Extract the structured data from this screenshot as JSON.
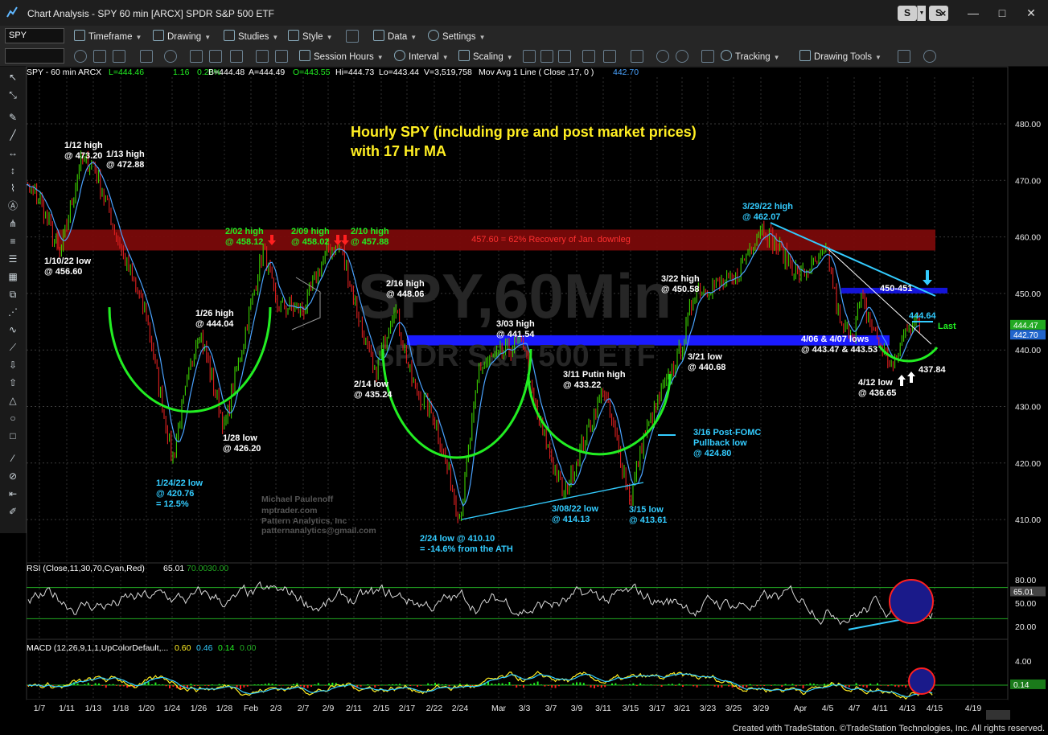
{
  "window": {
    "title": "Chart Analysis - SPY 60 min [ARCX] SPDR S&P 500 ETF",
    "s_button": "S",
    "link_button": "S"
  },
  "toolbar1": {
    "symbol": "SPY",
    "items": [
      "Timeframe",
      "Drawing",
      "Studies",
      "Style",
      "Data",
      "Settings"
    ]
  },
  "toolbar2": {
    "items": [
      "Session Hours",
      "Interval",
      "Scaling",
      "Tracking",
      "Drawing Tools"
    ]
  },
  "header": {
    "symbol": "SPY - 60 min  ARCX",
    "last": "L=444.46",
    "change": "1.16",
    "change_pct": "0.26%",
    "bid": "B=444.48",
    "ask": "A=444.49",
    "open": "O=443.55",
    "high": "Hi=444.73",
    "low": "Lo=443.44",
    "volume": "V=3,519,758",
    "ma_label": "Mov Avg 1 Line ( Close ,17,  0 )",
    "ma_value": "442.70"
  },
  "chart_title": [
    "Hourly SPY (including pre and post market prices)",
    "with 17 Hr MA"
  ],
  "watermark": {
    "main": "SPY,60Min",
    "sub": "SPDR S&P 500 ETF"
  },
  "credits": [
    "Michael Paulenoff",
    "mptrader.com",
    "Pattern Analytics, Inc",
    "patternanalytics@gmail.com"
  ],
  "zone_label": "457.60 = 62% Recovery of Jan. downleg",
  "colors": {
    "price_up": "#3cd000",
    "price_down": "#e02020",
    "ma": "#4aa3ff",
    "resistance_zone": "#7a0a0a",
    "support_zone": "#1a1aff",
    "cyan": "#33ccff",
    "green_arc": "#22ee22",
    "yellow": "#ffee22",
    "label_green": "#22ee22"
  },
  "annotations": [
    {
      "text": [
        "1/12 high",
        "@ 473.20"
      ]
    },
    {
      "text": [
        "1/13 high",
        "@ 472.88"
      ]
    },
    {
      "text": [
        "1/10/22 low",
        "@ 456.60"
      ]
    },
    {
      "text": [
        "2/02 high",
        "@ 458.12"
      ]
    },
    {
      "text": [
        "2/09 high",
        "@ 458.02"
      ]
    },
    {
      "text": [
        "2/10 high",
        "@ 457.88"
      ]
    },
    {
      "text": [
        "1/26 high",
        "@ 444.04"
      ]
    },
    {
      "text": [
        "2/16 high",
        "@ 448.06"
      ]
    },
    {
      "text": [
        "3/03 high",
        "@ 441.54"
      ]
    },
    {
      "text": [
        "3/22 high",
        "@ 450.58"
      ]
    },
    {
      "text": [
        "3/29/22 high",
        "@ 462.07"
      ]
    },
    {
      "text": [
        "2/14 low",
        "@ 435.24"
      ]
    },
    {
      "text": [
        "3/11 Putin high",
        "@ 433.22"
      ]
    },
    {
      "text": [
        "3/21 low",
        "@ 440.68"
      ]
    },
    {
      "text": [
        "1/28 low",
        "@ 426.20"
      ]
    },
    {
      "text": [
        "1/24/22 low",
        "@ 420.76",
        "= 12.5%"
      ]
    },
    {
      "text": [
        "2/24 low @ 410.10",
        "= -14.6% from the ATH"
      ]
    },
    {
      "text": [
        "3/08/22 low",
        "@ 414.13"
      ]
    },
    {
      "text": [
        "3/15 low",
        "@ 413.61"
      ]
    },
    {
      "text": [
        "3/16 Post-FOMC",
        "Pullback low",
        "@ 424.80"
      ]
    },
    {
      "text": [
        "4/06 & 4/07 lows",
        "@ 443.47 & 443.53"
      ]
    },
    {
      "text": [
        "4/12 low",
        "@ 436.65"
      ]
    },
    {
      "text": [
        "450-451"
      ]
    },
    {
      "text": [
        "444.64"
      ]
    },
    {
      "text": [
        "Last"
      ]
    },
    {
      "text": [
        "437.84"
      ]
    }
  ],
  "rsi": {
    "label": "RSI (Close,11,30,70,Cyan,Red)",
    "value": "65.01",
    "ob": "70.00",
    "os": "30.00",
    "axis": [
      "80.00",
      "50.00",
      "20.00"
    ],
    "tag": "65.01"
  },
  "macd": {
    "label": "MACD (12,26,9,1,1,UpColorDefault,...",
    "v1": "0.60",
    "v2": "0.46",
    "v3": "0.14",
    "v4": "0.00",
    "axis": [
      "4.00"
    ],
    "tag": "0.14"
  },
  "price_tags": [
    "444.47",
    "442.70"
  ],
  "footer": "Created with TradeStation. ©TradeStation Technologies, Inc. All rights reserved.",
  "chart_data": {
    "type": "line",
    "title": "Hourly SPY (including pre and post market prices)",
    "x_ticks": [
      "1/7",
      "1/11",
      "1/13",
      "1/18",
      "1/20",
      "1/24",
      "1/26",
      "1/28",
      "Feb",
      "2/3",
      "2/7",
      "2/9",
      "2/11",
      "2/15",
      "2/17",
      "2/22",
      "2/24",
      "Mar",
      "3/3",
      "3/7",
      "3/9",
      "3/11",
      "3/15",
      "3/17",
      "3/21",
      "3/23",
      "3/25",
      "3/29",
      "Apr",
      "4/5",
      "4/7",
      "4/11",
      "4/13",
      "4/15",
      "4/19"
    ],
    "y_ticks": [
      "480.00",
      "470.00",
      "460.00",
      "450.00",
      "440.00",
      "430.00",
      "420.00",
      "410.00"
    ],
    "ylim": [
      403,
      484
    ],
    "price_points": [
      [
        "1/5",
        470
      ],
      [
        "1/7",
        467
      ],
      [
        "1/10",
        456.6
      ],
      [
        "1/12",
        473.2
      ],
      [
        "1/13",
        472.88
      ],
      [
        "1/18",
        458
      ],
      [
        "1/20",
        446
      ],
      [
        "1/24",
        420.76
      ],
      [
        "1/26",
        444.04
      ],
      [
        "1/28",
        426.2
      ],
      [
        "2/2",
        458.12
      ],
      [
        "2/3",
        448
      ],
      [
        "2/7",
        447
      ],
      [
        "2/9",
        458.02
      ],
      [
        "2/10",
        457.88
      ],
      [
        "2/14",
        435.24
      ],
      [
        "2/16",
        448.06
      ],
      [
        "2/18",
        434
      ],
      [
        "2/22",
        428
      ],
      [
        "2/24",
        410.1
      ],
      [
        "2/28",
        437
      ],
      [
        "3/3",
        441.54
      ],
      [
        "3/4",
        432
      ],
      [
        "3/8",
        414.13
      ],
      [
        "3/11",
        433.22
      ],
      [
        "3/15",
        413.61
      ],
      [
        "3/16",
        424.8
      ],
      [
        "3/21",
        440.68
      ],
      [
        "3/22",
        450.58
      ],
      [
        "3/25",
        452
      ],
      [
        "3/29",
        462.07
      ],
      [
        "4/1",
        453
      ],
      [
        "4/5",
        457
      ],
      [
        "4/6",
        443.47
      ],
      [
        "4/7",
        443.53
      ],
      [
        "4/8",
        449
      ],
      [
        "4/11",
        441
      ],
      [
        "4/12",
        436.65
      ],
      [
        "4/13",
        444.64
      ],
      [
        "4/14",
        444.46
      ]
    ],
    "zones": [
      {
        "name": "457.60 = 62% Recovery of Jan. downleg",
        "from": 457.6,
        "to": 461.3
      },
      {
        "name": "support",
        "from": 440.8,
        "to": 442.6
      },
      {
        "name": "450-451",
        "from": 450,
        "to": 451
      }
    ],
    "last": 444.46,
    "ma_last": 442.7,
    "rsi_last": 65.01,
    "macd_last": 0.14
  }
}
